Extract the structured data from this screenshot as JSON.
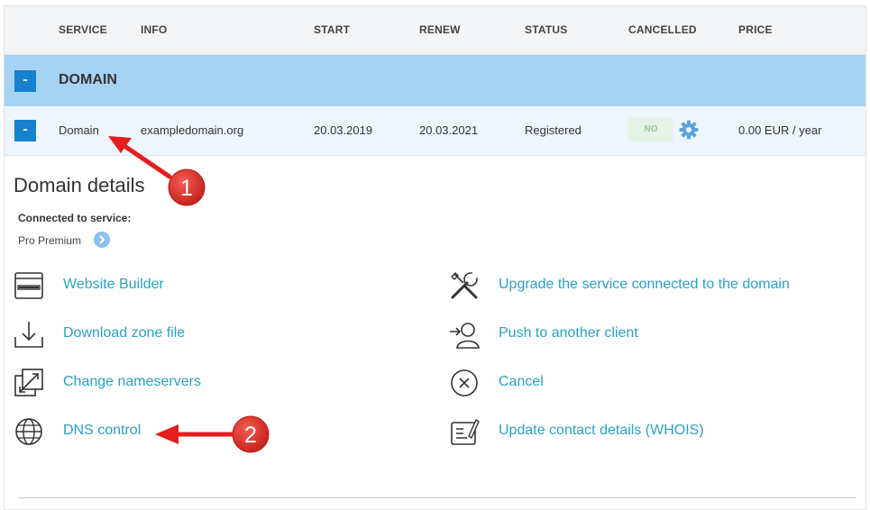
{
  "table": {
    "headers": [
      "SERVICE",
      "INFO",
      "START",
      "RENEW",
      "STATUS",
      "CANCELLED",
      "PRICE"
    ],
    "group": {
      "toggle": "-",
      "title": "DOMAIN"
    },
    "row": {
      "toggle": "-",
      "service": "Domain",
      "info": "exampledomain.org",
      "start": "20.03.2019",
      "renew": "20.03.2021",
      "status": "Registered",
      "cancelled": "NO",
      "price": "0.00 EUR / year"
    }
  },
  "details": {
    "title": "Domain details",
    "connected_label": "Connected to service:",
    "connected_value": "Pro Premium",
    "actions_left": [
      {
        "label": "Website Builder",
        "icon": "browser-window-icon"
      },
      {
        "label": "Download zone file",
        "icon": "download-icon"
      },
      {
        "label": "Change nameservers",
        "icon": "swap-arrows-icon"
      },
      {
        "label": "DNS control",
        "icon": "globe-icon"
      }
    ],
    "actions_right": [
      {
        "label": "Upgrade the service connected to the domain",
        "icon": "tools-icon"
      },
      {
        "label": "Push to another client",
        "icon": "user-transfer-icon"
      },
      {
        "label": "Cancel",
        "icon": "close-circle-icon"
      },
      {
        "label": "Update contact details (WHOIS)",
        "icon": "document-edit-icon"
      }
    ]
  },
  "annotations": {
    "marker_1": "1",
    "marker_2": "2"
  },
  "colors": {
    "accent": "#2aa1c6",
    "group_bg": "#a6d2f3",
    "button": "#1681cf",
    "marker": "#d9312b"
  }
}
